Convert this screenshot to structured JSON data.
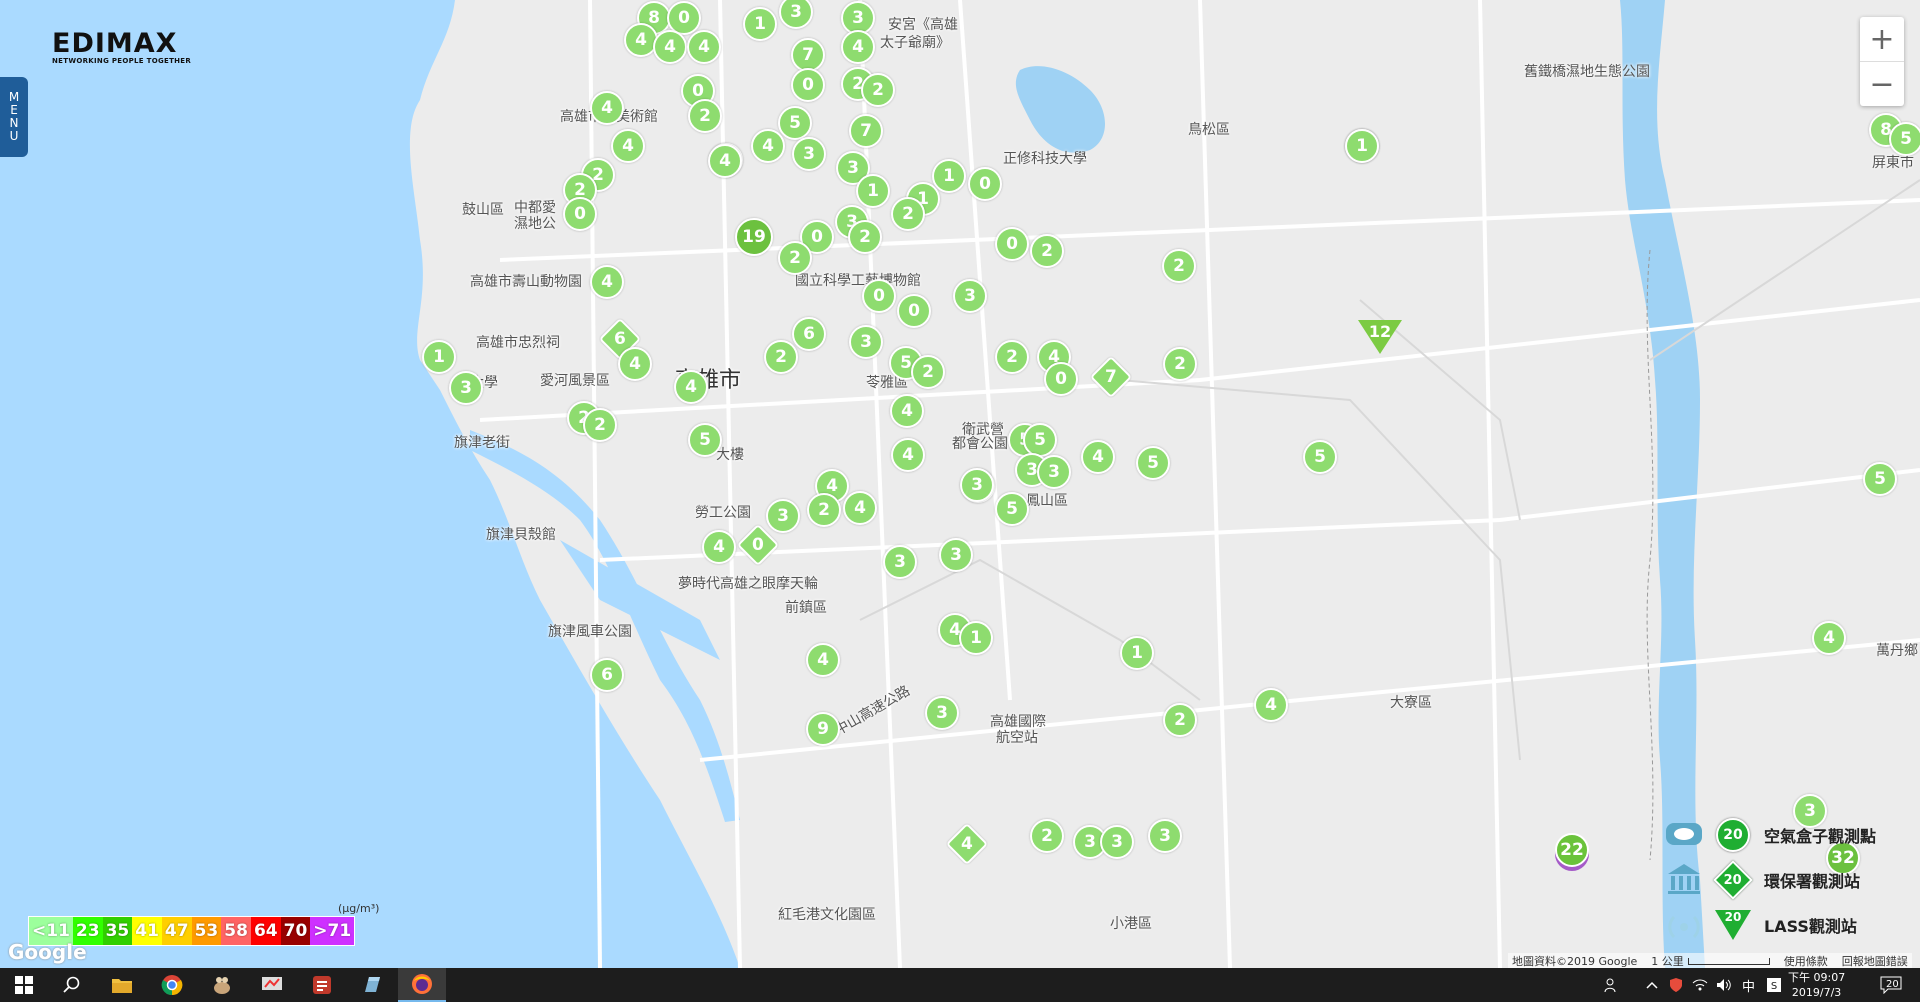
{
  "app": {
    "brand": "EDIMAX",
    "tagline": "NETWORKING PEOPLE TOGETHER",
    "menu_label": "MENU",
    "menu_letters": [
      "M",
      "E",
      "N",
      "U"
    ]
  },
  "zoom": {
    "in_label": "+",
    "out_label": "−"
  },
  "map": {
    "colors": {
      "sea": "#aadaff",
      "land": "#f2f2f2",
      "river": "#9fd2f4",
      "road": "#ffffff",
      "marker_light": "#8edc6f",
      "marker_dark": "#6cc13f"
    },
    "places": [
      {
        "name": "高雄市",
        "big": true
      },
      {
        "name": "鼓山區"
      },
      {
        "name": "中都愛"
      },
      {
        "name": "濕地公"
      },
      {
        "name": "高雄市壽山動物園"
      },
      {
        "name": "高雄市忠烈祠"
      },
      {
        "name": "愛河風景區"
      },
      {
        "name": "旗津老街"
      },
      {
        "name": "旗津貝殼館"
      },
      {
        "name": "旗津風車公園"
      },
      {
        "name": "勞工公園"
      },
      {
        "name": "夢時代高雄之眼摩天輪"
      },
      {
        "name": "前鎮區"
      },
      {
        "name": "苓雅區"
      },
      {
        "name": "衛武營"
      },
      {
        "name": "都會公園"
      },
      {
        "name": "鳳山區"
      },
      {
        "name": "鳥松區"
      },
      {
        "name": "正修科技大學"
      },
      {
        "name": "國立科學工藝博物館"
      },
      {
        "name": "高雄市立美術館"
      },
      {
        "name": "大寮區"
      },
      {
        "name": "小港區"
      },
      {
        "name": "高雄國際"
      },
      {
        "name": "航空站"
      },
      {
        "name": "紅毛港文化園區"
      },
      {
        "name": "舊鐵橋濕地生態公園"
      },
      {
        "name": "屏東市"
      },
      {
        "name": "萬丹鄉"
      },
      {
        "name": "大樓"
      },
      {
        "name": "大學"
      },
      {
        "name": "中山高速公路"
      },
      {
        "name": "安宮《高雄"
      },
      {
        "name": "太子爺廟》"
      }
    ],
    "markers": [
      {
        "v": "8"
      },
      {
        "v": "0"
      },
      {
        "v": "1"
      },
      {
        "v": "3"
      },
      {
        "v": "3"
      },
      {
        "v": "4"
      },
      {
        "v": "4"
      },
      {
        "v": "4"
      },
      {
        "v": "7"
      },
      {
        "v": "4"
      },
      {
        "v": "0"
      },
      {
        "v": "0"
      },
      {
        "v": "2"
      },
      {
        "v": "2"
      },
      {
        "v": "4"
      },
      {
        "v": "2"
      },
      {
        "v": "5"
      },
      {
        "v": "7"
      },
      {
        "v": "4"
      },
      {
        "v": "4"
      },
      {
        "v": "3"
      },
      {
        "v": "3"
      },
      {
        "v": "3"
      },
      {
        "v": "2"
      },
      {
        "v": "2"
      },
      {
        "v": "0"
      },
      {
        "v": "1"
      },
      {
        "v": "1"
      },
      {
        "v": "0"
      },
      {
        "v": "4"
      },
      {
        "v": "1"
      },
      {
        "v": "2"
      },
      {
        "v": "3"
      },
      {
        "v": "19"
      },
      {
        "v": "0"
      },
      {
        "v": "2"
      },
      {
        "v": "2"
      },
      {
        "v": "0"
      },
      {
        "v": "2"
      },
      {
        "v": "2"
      },
      {
        "v": "4"
      },
      {
        "v": "0"
      },
      {
        "v": "0"
      },
      {
        "v": "3"
      },
      {
        "v": "1"
      },
      {
        "v": "6"
      },
      {
        "v": "6"
      },
      {
        "v": "3"
      },
      {
        "v": "4"
      },
      {
        "v": "1"
      },
      {
        "v": "2"
      },
      {
        "v": "5"
      },
      {
        "v": "2"
      },
      {
        "v": "2"
      },
      {
        "v": "4"
      },
      {
        "v": "0"
      },
      {
        "v": "7"
      },
      {
        "v": "2"
      },
      {
        "v": "3"
      },
      {
        "v": "4"
      },
      {
        "v": "2"
      },
      {
        "v": "2"
      },
      {
        "v": "4"
      },
      {
        "v": "5"
      },
      {
        "v": "5"
      },
      {
        "v": "4"
      },
      {
        "v": "5"
      },
      {
        "v": "3"
      },
      {
        "v": "3"
      },
      {
        "v": "4"
      },
      {
        "v": "5"
      },
      {
        "v": "4"
      },
      {
        "v": "3"
      },
      {
        "v": "2"
      },
      {
        "v": "4"
      },
      {
        "v": "3"
      },
      {
        "v": "0"
      },
      {
        "v": "4"
      },
      {
        "v": "3"
      },
      {
        "v": "3"
      },
      {
        "v": "5"
      },
      {
        "v": "3"
      },
      {
        "v": "4"
      },
      {
        "v": "1"
      },
      {
        "v": "6"
      },
      {
        "v": "4"
      },
      {
        "v": "9"
      },
      {
        "v": "3"
      },
      {
        "v": "1"
      },
      {
        "v": "2"
      },
      {
        "v": "4"
      },
      {
        "v": "4"
      },
      {
        "v": "2"
      },
      {
        "v": "3"
      },
      {
        "v": "3"
      },
      {
        "v": "3"
      },
      {
        "v": "1"
      },
      {
        "v": "12"
      },
      {
        "v": "5"
      },
      {
        "v": "5"
      },
      {
        "v": "4"
      },
      {
        "v": "22"
      },
      {
        "v": "3"
      },
      {
        "v": "32"
      },
      {
        "v": "8"
      },
      {
        "v": "5"
      }
    ]
  },
  "legend": {
    "rows": [
      {
        "value": "20",
        "label": "空氣盒子觀測點"
      },
      {
        "value": "20",
        "label": "環保署觀測站"
      },
      {
        "value": "20",
        "label": "LASS觀測站"
      }
    ]
  },
  "scale": {
    "unit": "(μg/m³)",
    "segments": [
      {
        "label": "<11",
        "color": "#9cff9c"
      },
      {
        "label": "23",
        "color": "#31ff00"
      },
      {
        "label": "35",
        "color": "#31cf00"
      },
      {
        "label": "41",
        "color": "#ffff00"
      },
      {
        "label": "47",
        "color": "#ffcf00"
      },
      {
        "label": "53",
        "color": "#ff9a00"
      },
      {
        "label": "58",
        "color": "#ff6464"
      },
      {
        "label": "64",
        "color": "#ff0000"
      },
      {
        "label": "70",
        "color": "#990000"
      },
      {
        "label": ">71",
        "color": "#ce30ff"
      }
    ]
  },
  "attribution": {
    "google": "Google",
    "map_data": "地圖資料©2019 Google",
    "scale_text": "1 公里",
    "terms": "使用條款",
    "report": "回報地圖錯誤"
  },
  "taskbar": {
    "ime": "中",
    "time": "下午 09:07",
    "date": "2019/7/3",
    "notif_count": "20"
  }
}
